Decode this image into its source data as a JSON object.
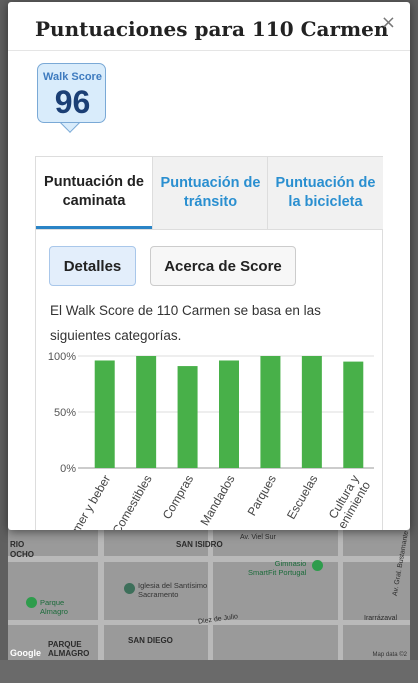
{
  "modal": {
    "title": "Puntuaciones para 110 Carmen",
    "close_glyph": "×"
  },
  "badge": {
    "label": "Walk Score",
    "score": "96"
  },
  "tabs": [
    {
      "label": "Puntuación de caminata",
      "active": true
    },
    {
      "label": "Puntuación de tránsito",
      "active": false
    },
    {
      "label": "Puntuación de la bicicleta",
      "active": false
    }
  ],
  "buttons": {
    "details": "Detalles",
    "about": "Acerca de Score"
  },
  "description": "El Walk Score de 110 Carmen se basa en las siguientes categorías.",
  "chart_data": {
    "type": "bar",
    "categories": [
      "Comer y beber",
      "Comestibles",
      "Compras",
      "Mandados",
      "Parques",
      "Escuelas",
      "Cultura y entretenimiento"
    ],
    "visible_category_text": [
      "mer y beber",
      "Comestibles",
      "Compras",
      "Mandados",
      "Parques",
      "Escuelas",
      "Cultura y\nenimiento"
    ],
    "values": [
      96,
      100,
      91,
      96,
      100,
      100,
      95
    ],
    "yticks": [
      "100%",
      "50%",
      "0%"
    ],
    "ylim": [
      0,
      100
    ],
    "bar_color": "#48b049",
    "grid": true
  },
  "map": {
    "labels": [
      "RIO",
      "OCHO",
      "SAN ISIDRO",
      "PARQUE",
      "ALMAGRO",
      "SAN DIEGO",
      "Av. Viel Sur",
      "Av. Gral. Bustamante",
      "Diez de Julio",
      "Irarrázaval"
    ],
    "pois": [
      "Iglesia del Santísimo\nSacramento",
      "Gimnasio\nSmartFit Portugal",
      "Parque\nAlmagro"
    ],
    "google": "Google",
    "credit": "Map data ©2"
  },
  "colors": {
    "link_blue": "#2a8fd0",
    "active_tab_underline": "#2a84c6",
    "badge_bg": "#d9ecfb",
    "badge_score": "#1b3f75"
  }
}
